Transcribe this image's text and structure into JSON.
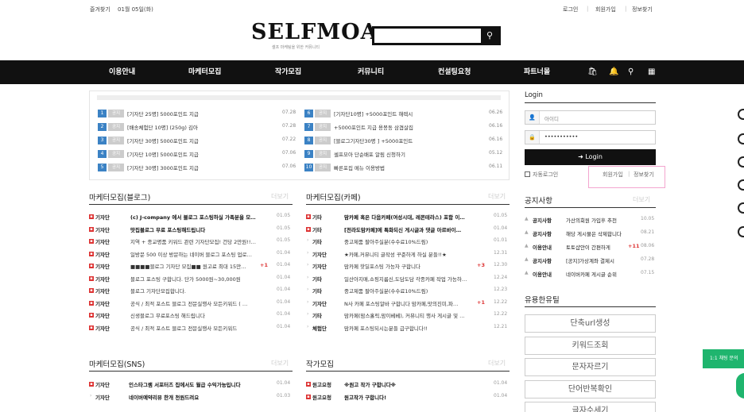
{
  "topbar": {
    "bookmark": "즐겨찾기",
    "date": "01월 05일(화)",
    "login": "로그인",
    "join": "회원가입",
    "find": "정보찾기"
  },
  "header": {
    "logo": "SELFMOA",
    "tagline": "셀프 마케팅을 위한 커뮤니티",
    "search_value": ""
  },
  "nav": {
    "items": [
      "이용안내",
      "마케터모집",
      "작가모집",
      "커뮤니티",
      "컨설팅요청",
      "파트너몰"
    ]
  },
  "notices": {
    "left": [
      {
        "num": "1",
        "tag": "공지",
        "text": "[기자단 25명] 5000포인트 지급",
        "date": "07.28"
      },
      {
        "num": "2",
        "tag": "공지",
        "text": "[배송체험단 10명] (250g) 김아",
        "date": "07.28"
      },
      {
        "num": "3",
        "tag": "공지",
        "text": "[기자단 30명] 5000포인트 지급",
        "date": "07.22"
      },
      {
        "num": "4",
        "tag": "공지",
        "text": "[기자단 10명] 5000포인트 지급",
        "date": "07.06"
      },
      {
        "num": "5",
        "tag": "공지",
        "text": "[기자단 30명] 3000포인트 지급",
        "date": "07.06"
      }
    ],
    "right": [
      {
        "num": "6",
        "tag": "공지",
        "text": "[기자단10명] +5000포인트 해렉시",
        "date": "06.26"
      },
      {
        "num": "7",
        "tag": "공지",
        "text": "+5000포인트 지급 용봉동 삼겹살집",
        "date": "06.16"
      },
      {
        "num": "8",
        "tag": "공지",
        "text": "[블로그기자단30명 ] +5000포인트",
        "date": "06.16"
      },
      {
        "num": "9",
        "tag": "공지",
        "text": "셀프모아 단순배포 알림 신청하기",
        "date": "05.12"
      },
      {
        "num": "10",
        "tag": "공지",
        "text": "빠른포집 메뉴 이용방법",
        "date": "06.11"
      }
    ]
  },
  "blog": {
    "title": "마케터모집(블로그)",
    "more": "더보기",
    "rows": [
      {
        "cat": "기자단",
        "text": "(c) J-company 에서 블로그 포스팅하실 가족분을 모…",
        "date": "01.05",
        "bold": true,
        "plus": ""
      },
      {
        "cat": "기자단",
        "text": "맛집블로그 무료 포스팅해드립니다",
        "date": "01.05",
        "bold": true,
        "plus": ""
      },
      {
        "cat": "기자단",
        "text": "지역 + 종교명품 키워드 관련 기자단모집! 건당 2만원!!…",
        "date": "01.05",
        "bold": false,
        "plus": ""
      },
      {
        "cat": "기자단",
        "text": "일방문 500 이상 방문하는 네이버 블로그 포스팅 업로…",
        "date": "01.04",
        "bold": false,
        "plus": ""
      },
      {
        "cat": "기자단",
        "text": "■■■■블로그 기자단 모집■■ 원고료 최대 15만…",
        "date": "01.04",
        "bold": false,
        "plus": "+1"
      },
      {
        "cat": "기자단",
        "text": "블로그 포스팅 구합니다. 단가 5000원~30,000원",
        "date": "01.04",
        "bold": false,
        "plus": ""
      },
      {
        "cat": "기자단",
        "text": "블로그 기자단모집합니다.",
        "date": "01.04",
        "bold": false,
        "plus": ""
      },
      {
        "cat": "기자단",
        "text": "공식 / 최적 포스트 블로그 전문실행사 모든키워드 ( …",
        "date": "01.04",
        "bold": false,
        "plus": ""
      },
      {
        "cat": "기자단",
        "text": "신생블로그 무료포스팅 해드립니다",
        "date": "01.04",
        "bold": false,
        "plus": ""
      },
      {
        "cat": "기자단",
        "text": "공식 / 최적 포스트 블로그 전문실행사 모든키워드",
        "date": "01.04",
        "bold": false,
        "plus": ""
      }
    ]
  },
  "cafe": {
    "title": "마케터모집(카페)",
    "more": "더보기",
    "rows": [
      {
        "cat": "기타",
        "text": "맘카페 혹은 다음카페(여성시대, 레몬테라스) 포함 이…",
        "date": "01.05",
        "bold": true,
        "plus": "",
        "marker": "box"
      },
      {
        "cat": "기타",
        "text": "[전라도맘카페]에 특화되신 게시글과 댓글 아르바이…",
        "date": "01.04",
        "bold": true,
        "plus": "",
        "marker": "box"
      },
      {
        "cat": "기타",
        "text": "중고제품 팔아주실분(수수료10%드림)",
        "date": "01.01",
        "bold": false,
        "plus": "",
        "marker": "arrow"
      },
      {
        "cat": "기자단",
        "text": "★카페,커뮤니티 글작성 꾸준하게 하실 분들!!★",
        "date": "12.31",
        "bold": false,
        "plus": "",
        "marker": "arrow"
      },
      {
        "cat": "기자단",
        "text": "맘카페 핫딜포스팅 가능자 구합니다",
        "date": "12.30",
        "bold": false,
        "plus": "+3",
        "marker": "arrow"
      },
      {
        "cat": "기타",
        "text": "일산아지매,쇼핑지름신,도담도담 각종카페 작업 가능하…",
        "date": "12.24",
        "bold": false,
        "plus": "",
        "marker": "arrow"
      },
      {
        "cat": "기타",
        "text": "중고제품 팔아주실분(수수료10%드림)",
        "date": "12.23",
        "bold": false,
        "plus": "",
        "marker": "arrow"
      },
      {
        "cat": "기자단",
        "text": "N사 카페 포스팅알바 구합니다 맘카페,맛의진미,파…",
        "date": "12.22",
        "bold": false,
        "plus": "+1",
        "marker": "arrow"
      },
      {
        "cat": "기타",
        "text": "맘카페(맘스홀릭,맘이베베), 커뮤니티 행사 게시글 및 …",
        "date": "12.22",
        "bold": false,
        "plus": "",
        "marker": "arrow"
      },
      {
        "cat": "체험단",
        "text": "맘카페 포스팅되시는분들 급구합니다!!",
        "date": "12.21",
        "bold": false,
        "plus": "",
        "marker": "arrow"
      }
    ]
  },
  "sns": {
    "title": "마케터모집(SNS)",
    "more": "더보기",
    "rows": [
      {
        "cat": "기자단",
        "text": "인스타그램 서포터즈 집에서도 월급 수익가능입니다",
        "date": "01.04",
        "bold": true,
        "marker": "box"
      },
      {
        "cat": "기자단",
        "text": "네이버예약리뷰 한개 천원드려요",
        "date": "01.03",
        "bold": true,
        "marker": "arrow"
      }
    ]
  },
  "writer": {
    "title": "작가모집",
    "more": "더보기",
    "rows": [
      {
        "cat": "원고요청",
        "text": "※원고 작가 구합니다※",
        "date": "01.04",
        "bold": true,
        "marker": "box"
      },
      {
        "cat": "원고요청",
        "text": "원고작가 구합니다!",
        "date": "01.04",
        "bold": true,
        "marker": "box"
      }
    ]
  },
  "login": {
    "title": "Login",
    "id_placeholder": "아이디",
    "password_mask": "•••••••••••",
    "button": "Login",
    "auto_login": "자동로그인",
    "join": "회원가입",
    "find": "정보찾기"
  },
  "notice_board": {
    "title": "공지사항",
    "more": "더보기",
    "rows": [
      {
        "cat": "공지사항",
        "text": "가산의회원 가입후 추천",
        "date": "10.05",
        "plus": ""
      },
      {
        "cat": "공지사항",
        "text": "해당 게시물은 삭제합니다",
        "date": "08.21",
        "plus": ""
      },
      {
        "cat": "이용안내",
        "text": "토토샵안이 간편하게",
        "date": "08.06",
        "plus": "+11"
      },
      {
        "cat": "공지사항",
        "text": "[공지]가상계좌 결제시",
        "date": "07.28",
        "plus": ""
      },
      {
        "cat": "이용안내",
        "text": "네이버카페 게시글 순위",
        "date": "07.15",
        "plus": ""
      }
    ]
  },
  "utilities": {
    "title": "유용한유틸",
    "items": [
      "단축url생성",
      "키워드조회",
      "문자자르기",
      "단어반복확인",
      "글자수세기"
    ]
  },
  "chat": {
    "label": "1:1 채팅 문의"
  },
  "colors": {
    "nav_bg": "#111111",
    "number_badge": "#3b82c4",
    "category_box": "#dd3333",
    "chat_green": "#1fb56e",
    "highlight_pink": "#f3a6cf"
  }
}
